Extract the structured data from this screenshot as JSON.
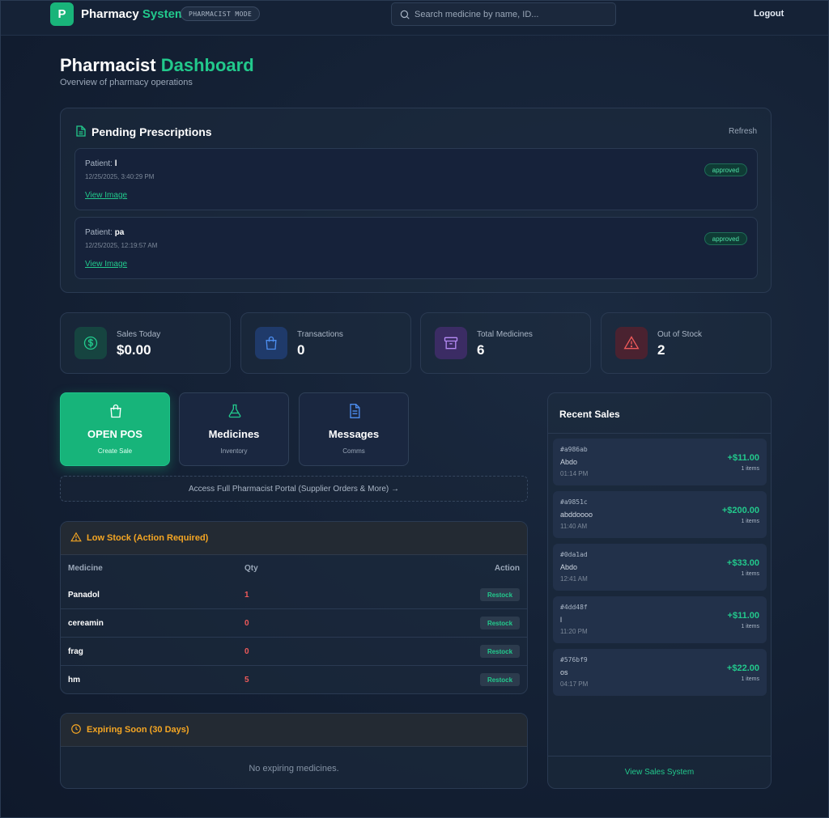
{
  "colors": {
    "accent": "#22c98c",
    "warning": "#f5a623",
    "danger": "#ef5a5a",
    "background": "#152236"
  },
  "topbar": {
    "logo_letter": "P",
    "brand_main": "Pharmacy",
    "brand_accent": "System",
    "mode_badge": "PHARMACIST MODE",
    "search_placeholder": "Search medicine by name, ID...",
    "logout": "Logout"
  },
  "header": {
    "title_main": "Pharmacist",
    "title_accent": "Dashboard",
    "subtitle": "Overview of pharmacy operations"
  },
  "prescriptions": {
    "title": "Pending Prescriptions",
    "refresh": "Refresh",
    "patient_label": "Patient:",
    "items": [
      {
        "patient": "l",
        "date": "12/25/2025, 3:40:29 PM",
        "link": "View Image",
        "status": "approved"
      },
      {
        "patient": "pa",
        "date": "12/25/2025, 12:19:57 AM",
        "link": "View Image",
        "status": "approved"
      }
    ]
  },
  "stats": [
    {
      "label": "Sales Today",
      "value": "$0.00",
      "icon": "dollar-icon"
    },
    {
      "label": "Transactions",
      "value": "0",
      "icon": "shopping-bag-icon"
    },
    {
      "label": "Total Medicines",
      "value": "6",
      "icon": "archive-box-icon"
    },
    {
      "label": "Out of Stock",
      "value": "2",
      "icon": "alert-triangle-icon"
    }
  ],
  "quick_actions": [
    {
      "title": "OPEN POS",
      "subtitle": "Create Sale",
      "icon": "shopping-bag-icon"
    },
    {
      "title": "Medicines",
      "subtitle": "Inventory",
      "icon": "flask-icon"
    },
    {
      "title": "Messages",
      "subtitle": "Comms",
      "icon": "document-icon"
    }
  ],
  "portal_link": "Access Full Pharmacist Portal (Supplier Orders & More) →",
  "low_stock": {
    "title": "Low Stock (Action Required)",
    "columns": [
      "Medicine",
      "Qty",
      "Action"
    ],
    "action_label": "Restock",
    "rows": [
      {
        "name": "Panadol",
        "qty": "1"
      },
      {
        "name": "cereamin",
        "qty": "0"
      },
      {
        "name": "frag",
        "qty": "0"
      },
      {
        "name": "hm",
        "qty": "5"
      }
    ]
  },
  "expiring": {
    "title": "Expiring Soon (30 Days)",
    "empty": "No expiring medicines."
  },
  "recent_sales": {
    "title": "Recent Sales",
    "footer": "View Sales System",
    "items": [
      {
        "id": "#a986ab",
        "name": "Abdo",
        "time": "01:14 PM",
        "amount": "+$11.00",
        "items": "1 items"
      },
      {
        "id": "#a9851c",
        "name": "abddoooo",
        "time": "11:40 AM",
        "amount": "+$200.00",
        "items": "1 items"
      },
      {
        "id": "#0da1ad",
        "name": "Abdo",
        "time": "12:41 AM",
        "amount": "+$33.00",
        "items": "1 items"
      },
      {
        "id": "#4dd48f",
        "name": "l",
        "time": "11:20 PM",
        "amount": "+$11.00",
        "items": "1 items"
      },
      {
        "id": "#576bf9",
        "name": "os",
        "time": "04:17 PM",
        "amount": "+$22.00",
        "items": "1 items"
      }
    ]
  }
}
